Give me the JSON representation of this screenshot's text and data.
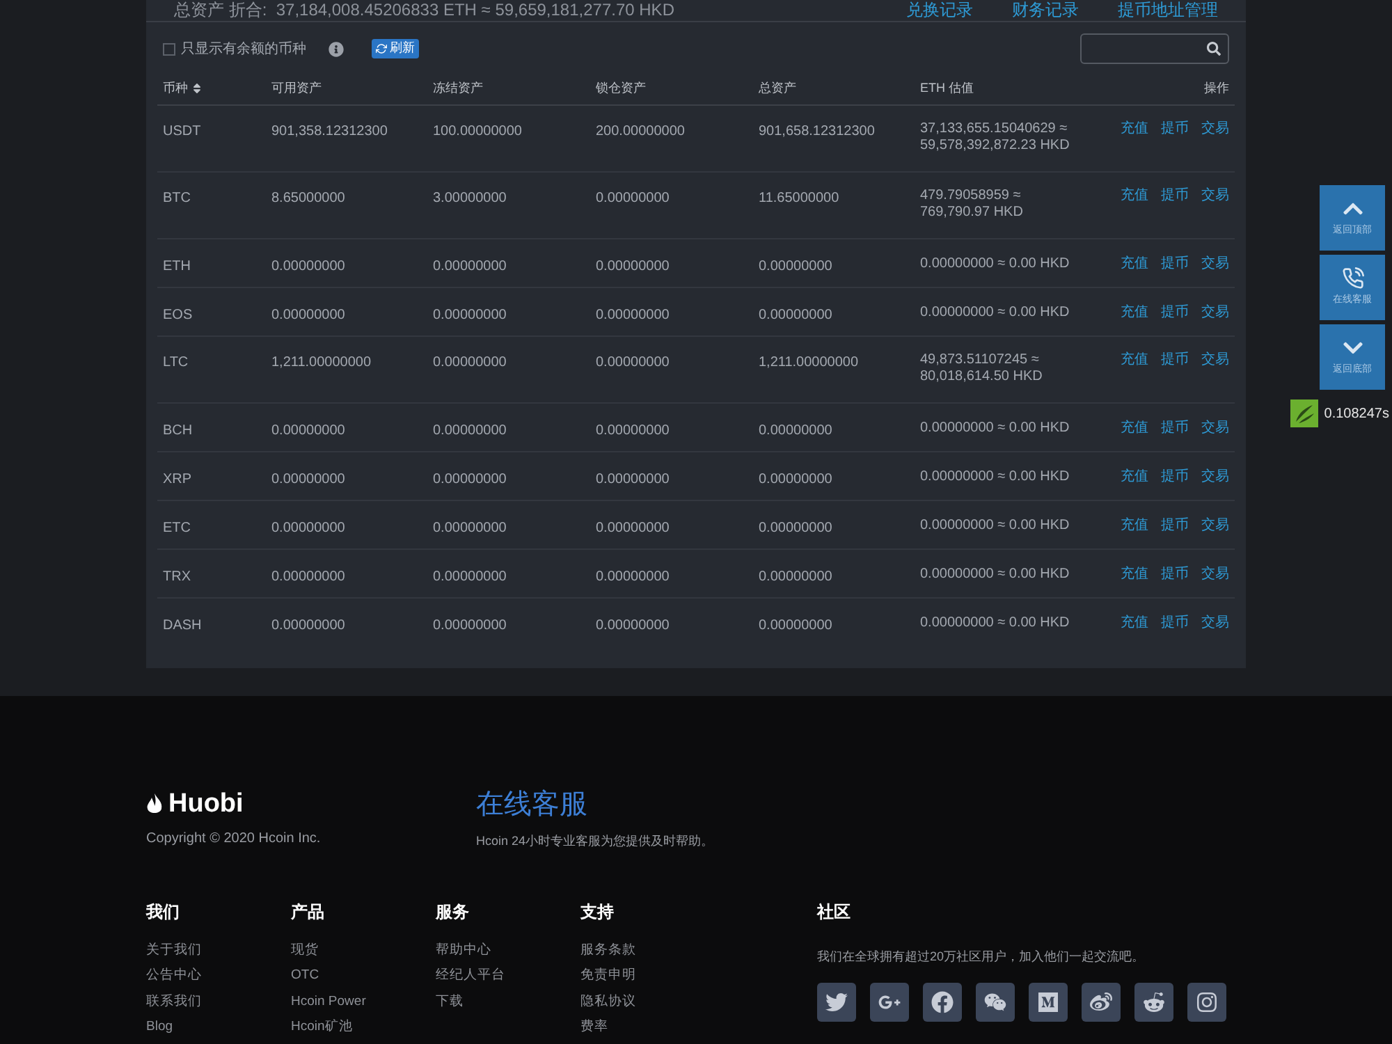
{
  "summary": {
    "label": "总资产 折合:",
    "value": "37,184,008.45206833 ETH ≈ 59,659,181,277.70 HKD"
  },
  "top_links": [
    "兑换记录",
    "财务记录",
    "提币地址管理"
  ],
  "filter": {
    "label": "只显示有余额的币种",
    "checked": false
  },
  "refresh_button": "刷新",
  "table": {
    "columns": [
      "币种",
      "可用资产",
      "冻结资产",
      "锁仓资产",
      "总资产",
      "ETH 估值",
      "操作"
    ],
    "rows": [
      {
        "coin": "USDT",
        "available": "901,358.12312300",
        "frozen": "100.00000000",
        "locked": "200.00000000",
        "total": "901,658.12312300",
        "estimate": [
          "37,133,655.15040629 ≈",
          "59,578,392,872.23 HKD"
        ],
        "actions": [
          "充值",
          "提币",
          "交易"
        ]
      },
      {
        "coin": "BTC",
        "available": "8.65000000",
        "frozen": "3.00000000",
        "locked": "0.00000000",
        "total": "11.65000000",
        "estimate": [
          "479.79058959 ≈",
          "769,790.97 HKD"
        ],
        "actions": [
          "充值",
          "提币",
          "交易"
        ]
      },
      {
        "coin": "ETH",
        "available": "0.00000000",
        "frozen": "0.00000000",
        "locked": "0.00000000",
        "total": "0.00000000",
        "estimate": [
          "0.00000000 ≈ 0.00 HKD"
        ],
        "actions": [
          "充值",
          "提币",
          "交易"
        ]
      },
      {
        "coin": "EOS",
        "available": "0.00000000",
        "frozen": "0.00000000",
        "locked": "0.00000000",
        "total": "0.00000000",
        "estimate": [
          "0.00000000 ≈ 0.00 HKD"
        ],
        "actions": [
          "充值",
          "提币",
          "交易"
        ]
      },
      {
        "coin": "LTC",
        "available": "1,211.00000000",
        "frozen": "0.00000000",
        "locked": "0.00000000",
        "total": "1,211.00000000",
        "estimate": [
          "49,873.51107245 ≈",
          "80,018,614.50 HKD"
        ],
        "actions": [
          "充值",
          "提币",
          "交易"
        ]
      },
      {
        "coin": "BCH",
        "available": "0.00000000",
        "frozen": "0.00000000",
        "locked": "0.00000000",
        "total": "0.00000000",
        "estimate": [
          "0.00000000 ≈ 0.00 HKD"
        ],
        "actions": [
          "充值",
          "提币",
          "交易"
        ]
      },
      {
        "coin": "XRP",
        "available": "0.00000000",
        "frozen": "0.00000000",
        "locked": "0.00000000",
        "total": "0.00000000",
        "estimate": [
          "0.00000000 ≈ 0.00 HKD"
        ],
        "actions": [
          "充值",
          "提币",
          "交易"
        ]
      },
      {
        "coin": "ETC",
        "available": "0.00000000",
        "frozen": "0.00000000",
        "locked": "0.00000000",
        "total": "0.00000000",
        "estimate": [
          "0.00000000 ≈ 0.00 HKD"
        ],
        "actions": [
          "充值",
          "提币",
          "交易"
        ]
      },
      {
        "coin": "TRX",
        "available": "0.00000000",
        "frozen": "0.00000000",
        "locked": "0.00000000",
        "total": "0.00000000",
        "estimate": [
          "0.00000000 ≈ 0.00 HKD"
        ],
        "actions": [
          "充值",
          "提币",
          "交易"
        ]
      },
      {
        "coin": "DASH",
        "available": "0.00000000",
        "frozen": "0.00000000",
        "locked": "0.00000000",
        "total": "0.00000000",
        "estimate": [
          "0.00000000 ≈ 0.00 HKD"
        ],
        "actions": [
          "充值",
          "提币",
          "交易"
        ]
      }
    ]
  },
  "side_buttons": [
    {
      "kind": "up",
      "label": "返回顶部"
    },
    {
      "kind": "phone",
      "label": "在线客服"
    },
    {
      "kind": "down",
      "label": "返回底部"
    }
  ],
  "timer": "0.108247s",
  "footer": {
    "logo": "Huobi",
    "copyright": "Copyright © 2020 Hcoin Inc.",
    "service": {
      "title": "在线客服",
      "text": "Hcoin 24小时专业客服为您提供及时帮助。"
    },
    "columns": [
      {
        "title": "我们",
        "links": [
          "关于我们",
          "公告中心",
          "联系我们",
          "Blog"
        ]
      },
      {
        "title": "产品",
        "links": [
          "现货",
          "OTC",
          "Hcoin Power",
          "Hcoin矿池"
        ]
      },
      {
        "title": "服务",
        "links": [
          "帮助中心",
          "经纪人平台",
          "下载"
        ]
      },
      {
        "title": "支持",
        "links": [
          "服务条款",
          "免责申明",
          "隐私协议",
          "费率"
        ]
      }
    ],
    "community": {
      "title": "社区",
      "text": "我们在全球拥有超过20万社区用户，加入他们一起交流吧。",
      "socials": [
        {
          "kind": "twitter"
        },
        {
          "kind": "google-plus"
        },
        {
          "kind": "facebook"
        },
        {
          "kind": "wechat"
        },
        {
          "kind": "medium"
        },
        {
          "kind": "weibo"
        },
        {
          "kind": "reddit"
        },
        {
          "kind": "instagram"
        }
      ]
    }
  }
}
